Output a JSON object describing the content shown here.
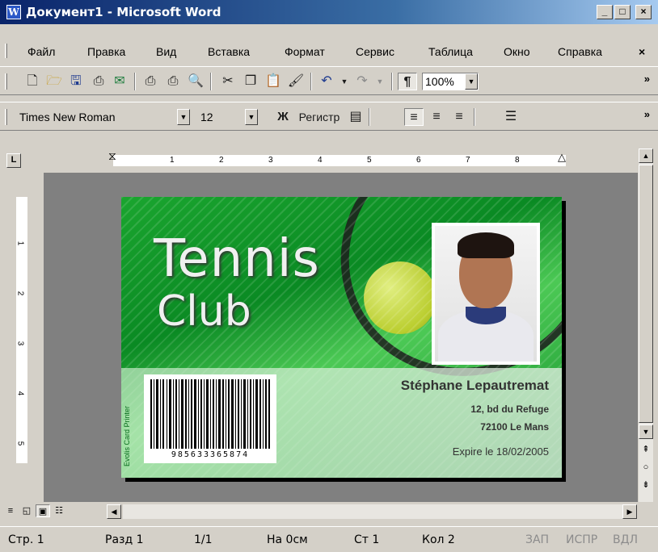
{
  "window": {
    "title": "Документ1 - Microsoft Word",
    "app_icon_letter": "W",
    "controls": {
      "minimize": "_",
      "maximize": "□",
      "close": "×"
    }
  },
  "menu": {
    "items": [
      "Файл",
      "Правка",
      "Вид",
      "Вставка",
      "Формат",
      "Сервис",
      "Таблица",
      "Окно",
      "Справка"
    ],
    "close_doc": "×"
  },
  "standard_toolbar": {
    "zoom_value": "100%",
    "more": "»"
  },
  "formatting_toolbar": {
    "font_name": "Times New Roman",
    "font_size": "12",
    "bold_glyph": "Ж",
    "style_label": "Регистр",
    "more": "»"
  },
  "ruler": {
    "tab_selector": "L",
    "h_numbers": [
      "1",
      "2",
      "3",
      "4",
      "5",
      "6",
      "7",
      "8"
    ],
    "v_numbers": [
      "1",
      "2",
      "3",
      "4",
      "5"
    ]
  },
  "card": {
    "title_line1": "Tennis",
    "title_line2": "Club",
    "printer_text": "Evolis Card Printer",
    "barcode_number": "985633365874",
    "holder_name": "Stéphane Lepautremat",
    "address_line1": "12, bd du Refuge",
    "address_line2": "72100 Le Mans",
    "expiry": "Expire le 18/02/2005"
  },
  "status": {
    "page": "Стр. 1",
    "section": "Разд 1",
    "pages": "1/1",
    "at": "На 0см",
    "line": "Ст 1",
    "column": "Кол 2",
    "rec": "ЗАП",
    "trk": "ИСПР",
    "ext": "ВДЛ"
  },
  "colors": {
    "titlebar_start": "#0a246a",
    "titlebar_end": "#a6caf0",
    "card_green": "#0a8a23",
    "chrome": "#d4d0c8"
  }
}
